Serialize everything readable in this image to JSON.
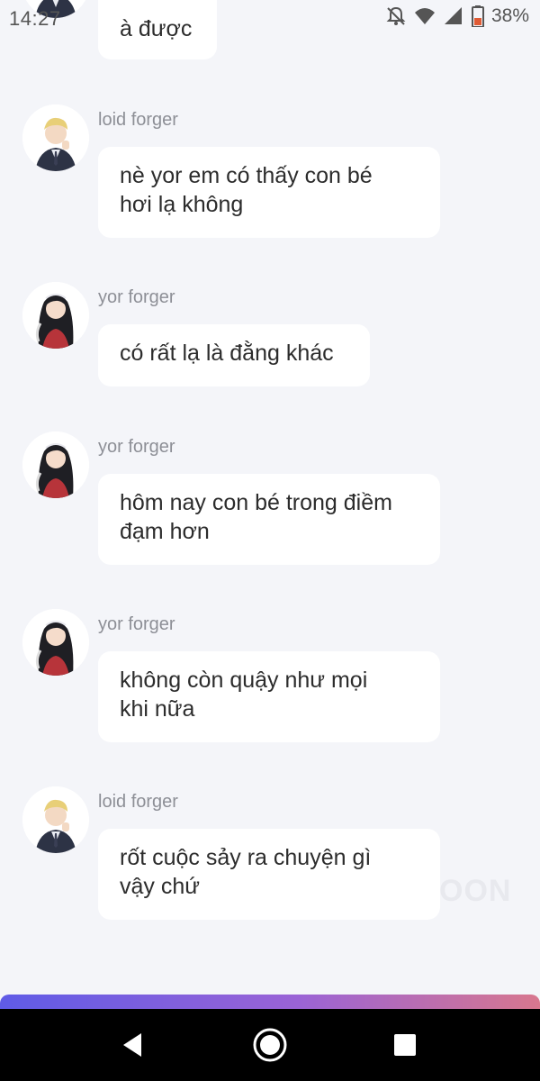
{
  "status_bar": {
    "time": "14:27",
    "battery": "38%",
    "icons": [
      "notifications-off-icon",
      "wifi-icon",
      "signal-icon",
      "battery-icon"
    ]
  },
  "colors": {
    "background": "#f4f5f9",
    "bubble": "#ffffff",
    "sender_text": "#8d8f96",
    "gradient_start": "#5f5be6",
    "gradient_end": "#d8778e"
  },
  "messages": [
    {
      "sender": "",
      "text": "à được",
      "avatar": "loid-avatar"
    },
    {
      "sender": "loid forger",
      "text": "nè yor em có thấy con bé\nhơi lạ không",
      "avatar": "loid-avatar"
    },
    {
      "sender": "yor forger",
      "text": "có rất lạ là đằng khác",
      "avatar": "yor-avatar"
    },
    {
      "sender": "yor forger",
      "text": "hôm nay con bé trong điềm\nđạm hơn",
      "avatar": "yor-avatar"
    },
    {
      "sender": "yor forger",
      "text": "không còn quậy như mọi\nkhi nữa",
      "avatar": "yor-avatar"
    },
    {
      "sender": "loid forger",
      "text": "rốt cuộc sảy ra chuyện gì\nvậy chứ",
      "avatar": "loid-avatar"
    }
  ],
  "watermark": "OON",
  "nav": [
    "back-icon",
    "home-icon",
    "recents-icon"
  ]
}
